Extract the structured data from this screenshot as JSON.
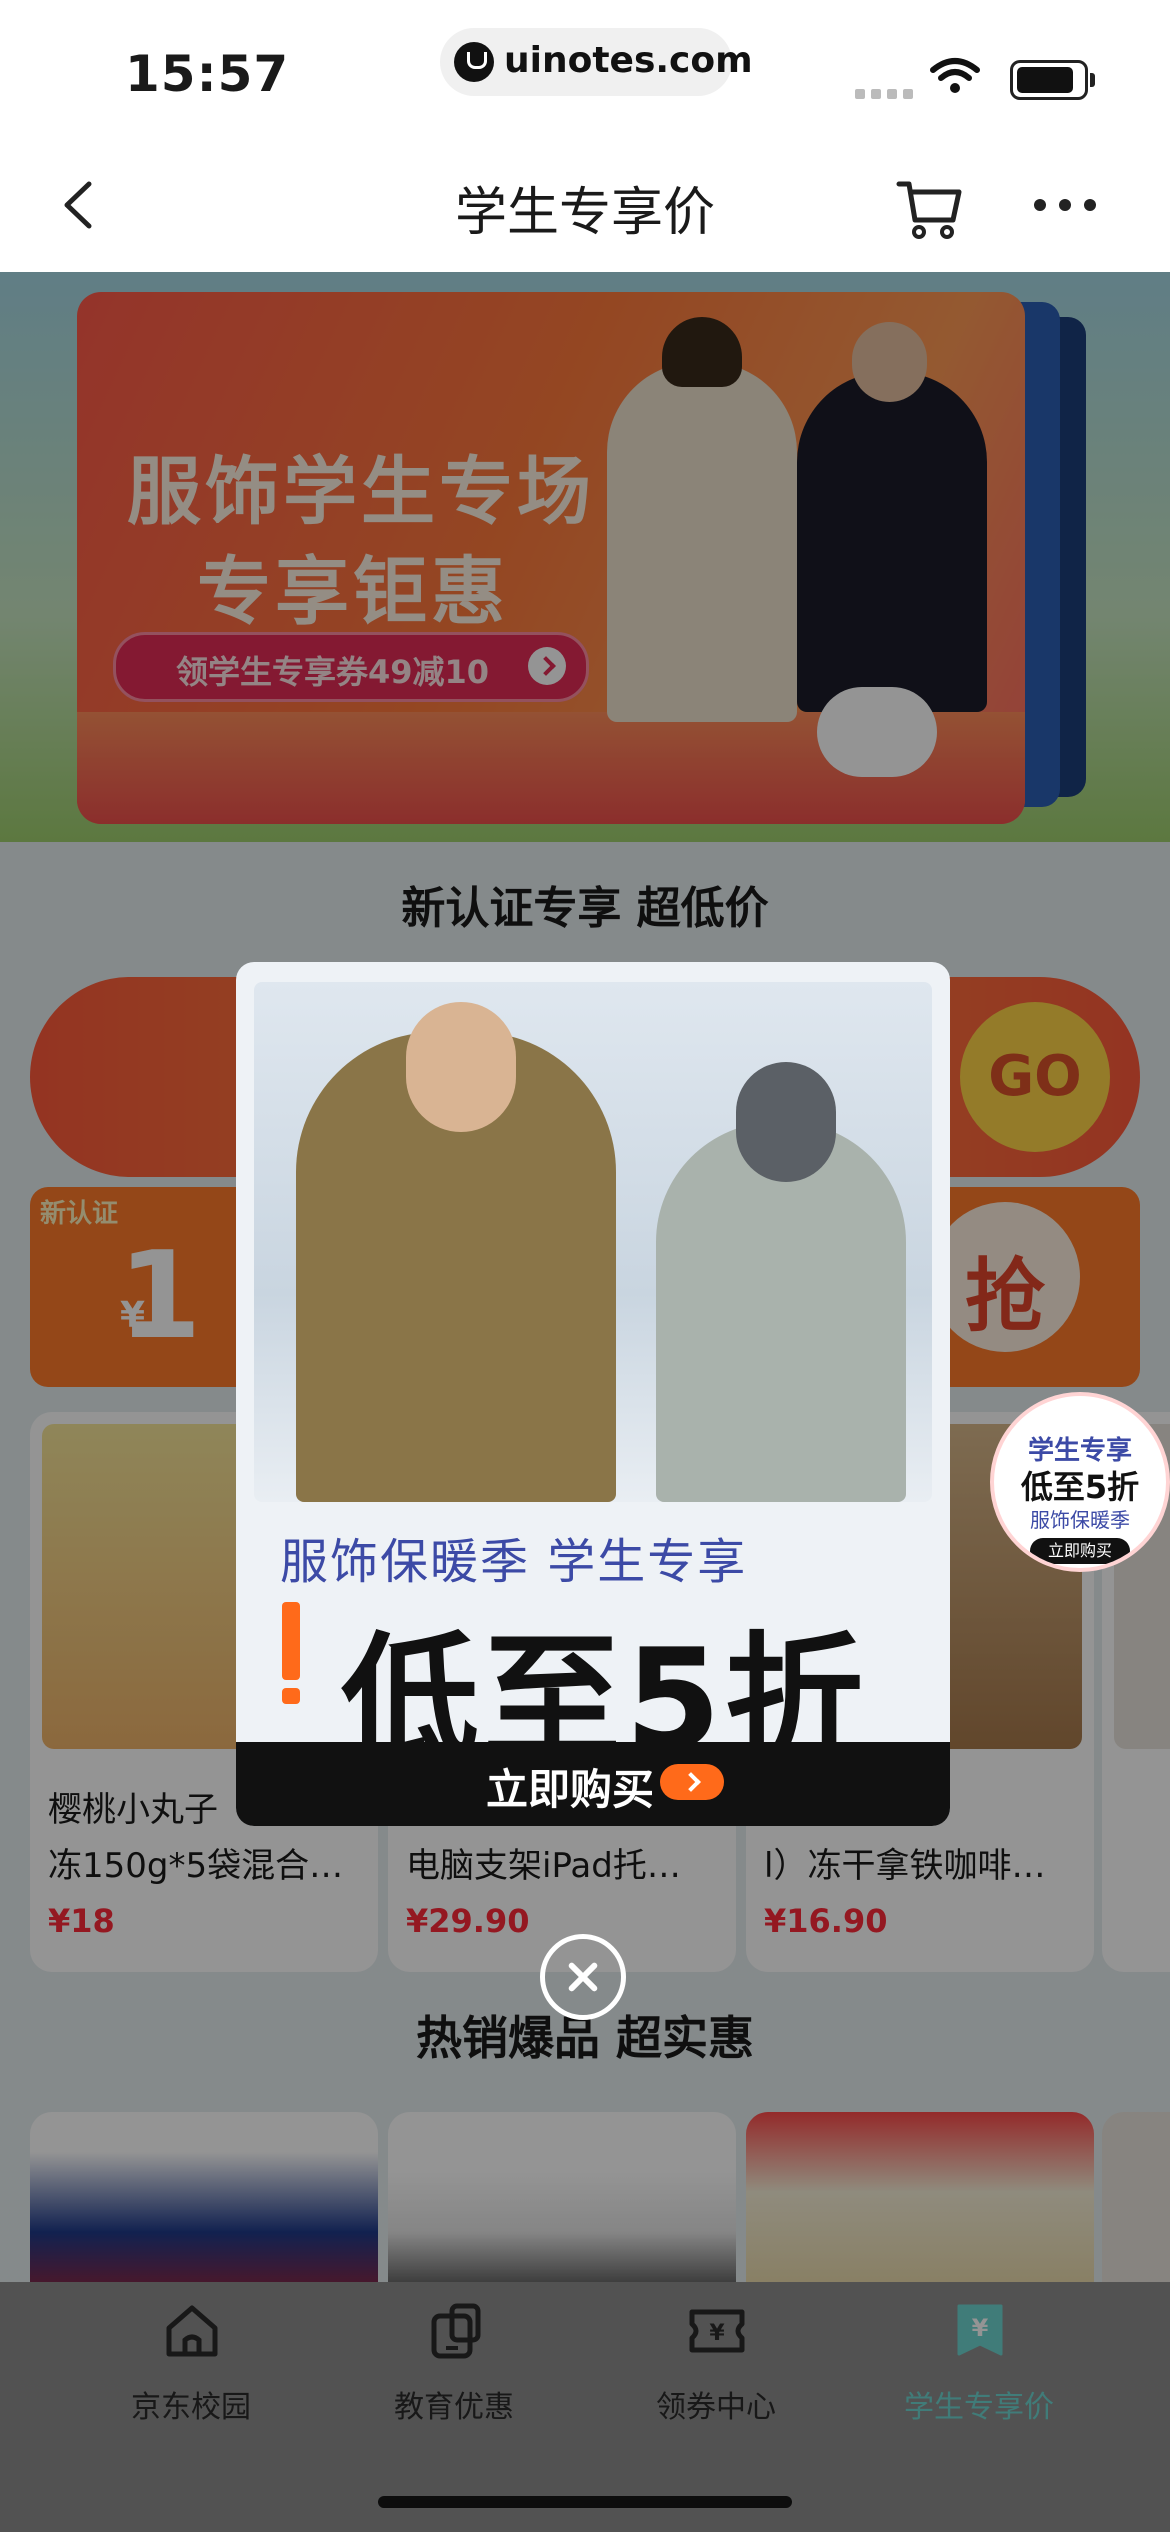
{
  "status": {
    "time": "15:57",
    "url": "uinotes.com"
  },
  "nav": {
    "title": "学生专享价"
  },
  "banner": {
    "line1": "服饰学生专场",
    "line2": "专享钜惠",
    "coupon": "领学生专享券49减10"
  },
  "section1": {
    "title": "新认证专享 超低价"
  },
  "promo": {
    "go": "GO",
    "tag": "新认证",
    "currency": "¥",
    "amount": "1",
    "grab": "抢"
  },
  "products": [
    {
      "name": "樱桃小丸子\n冻150g*5袋混合…",
      "price": "¥18",
      "img_color": "#f3d66a"
    },
    {
      "name": "\n电脑支架iPad托…",
      "price": "¥29.90",
      "img_color": "#c9c9c9"
    },
    {
      "name": "NGFE\nl）冻干拿铁咖啡…",
      "price": "¥16.90",
      "img_color": "#c7a57a"
    }
  ],
  "section2": {
    "title": "热销爆品 超实惠"
  },
  "popup": {
    "subtitle": "服饰保暖季 学生专享",
    "headline": "低至5折",
    "button": "立即购买"
  },
  "float_badge": {
    "l1": "学生专享",
    "l2": "低至5折",
    "l3": "服饰保暖季",
    "l4": "立即购买"
  },
  "tabs": [
    {
      "label": "京东校园",
      "icon": "home-icon",
      "active": false
    },
    {
      "label": "教育优惠",
      "icon": "devices-icon",
      "active": false
    },
    {
      "label": "领券中心",
      "icon": "ticket-icon",
      "active": false
    },
    {
      "label": "学生专享价",
      "icon": "price-tag-icon",
      "active": true
    }
  ],
  "colors": {
    "accent": "#6fd6d0",
    "price": "#ff2a3a",
    "banner": "#ff7a3c"
  }
}
